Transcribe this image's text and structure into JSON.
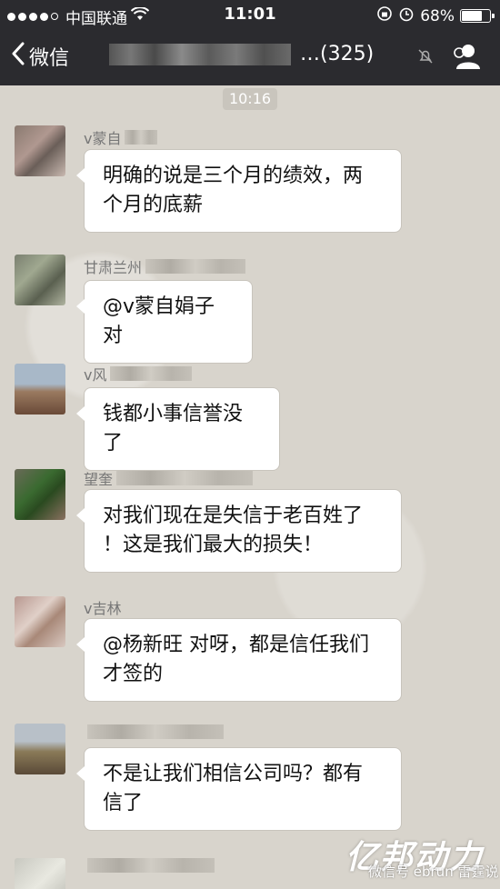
{
  "status": {
    "carrier": "中国联通",
    "time": "11:01",
    "battery_pct": "68%"
  },
  "nav": {
    "back_label": "微信",
    "title_suffix": "…(325)"
  },
  "chat": {
    "timestamp": "10:16",
    "messages": [
      {
        "sender": "v蒙自",
        "text_lines": [
          "明确的说是三个月的绩效，两",
          "个月的底薪"
        ]
      },
      {
        "sender": "甘肃兰州",
        "text_lines": [
          "@v蒙自娟子 对"
        ]
      },
      {
        "sender": "v风",
        "text_lines": [
          "钱都小事信誉没了"
        ]
      },
      {
        "sender": "望奎",
        "text_lines": [
          "对我们现在是失信于老百姓了",
          "！这是我们最大的损失！"
        ]
      },
      {
        "sender": "v吉林",
        "text_lines": [
          "@杨新旺 对呀，都是信任我们",
          "才签的"
        ]
      },
      {
        "sender": "",
        "text_lines": [
          "不是让我们相信公司吗？都有",
          "信了"
        ]
      }
    ]
  },
  "watermark": {
    "brand": "亿邦动力",
    "sub": "微信号 ebrun 雷霆说"
  },
  "colors": {
    "bar_bg": "#2b2b2f",
    "chat_bg": "#d8d4cc",
    "bubble": "#ffffff"
  }
}
